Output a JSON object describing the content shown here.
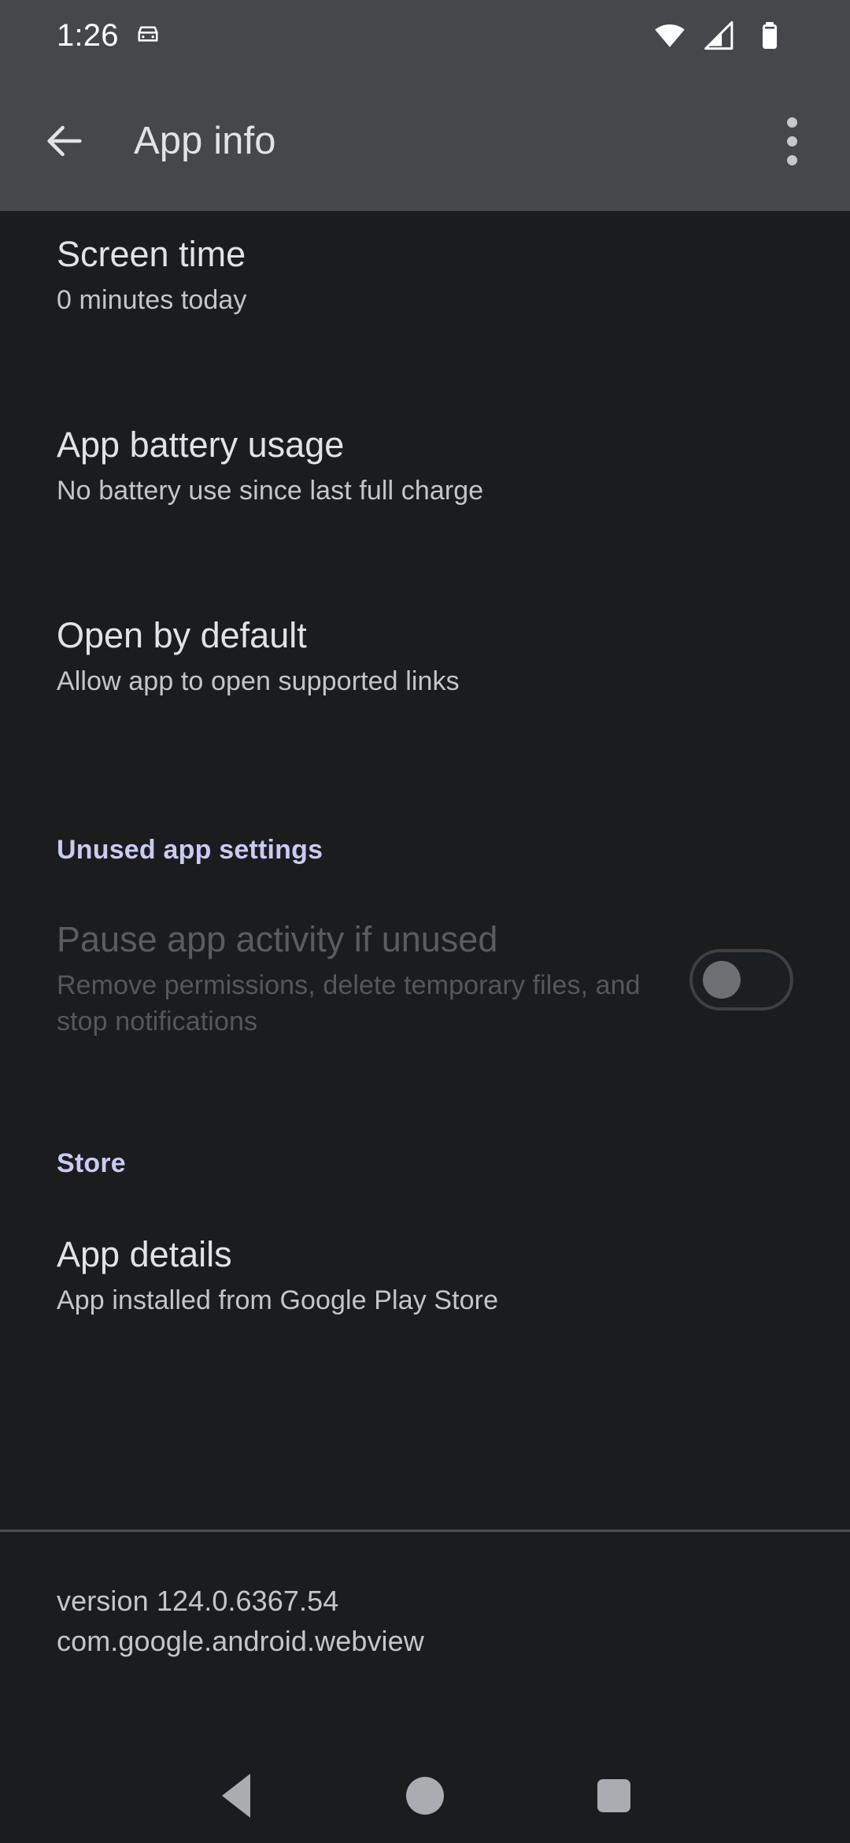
{
  "status_bar": {
    "time": "1:26",
    "icons": [
      "car-icon",
      "wifi-icon",
      "cellular-signal-icon",
      "battery-icon"
    ],
    "background_color": "#46474b",
    "foreground_color": "#ffffff"
  },
  "app_bar": {
    "back_icon": "back-arrow-icon",
    "title": "App info",
    "overflow_icon": "overflow-menu-icon",
    "background_color": "#46474b",
    "title_color": "#e3e2e6"
  },
  "preferences": [
    {
      "key": "screen_time",
      "title": "Screen time",
      "subtitle": "0 minutes today",
      "enabled": true
    },
    {
      "key": "app_battery_usage",
      "title": "App battery usage",
      "subtitle": "No battery use since last full charge",
      "enabled": true
    },
    {
      "key": "open_by_default",
      "title": "Open by default",
      "subtitle": "Allow app to open supported links",
      "enabled": true
    }
  ],
  "sections": {
    "unused_app_settings": {
      "header": "Unused app settings",
      "header_color": "#c8ccf2",
      "item": {
        "title": "Pause app activity if unused",
        "subtitle": "Remove permissions, delete temporary files, and stop notifications",
        "enabled": false,
        "toggle": {
          "name": "pause-app-activity-switch",
          "checked": false,
          "track_color": "#1c1f21",
          "border_color": "#3e4043",
          "thumb_color": "#6c7075"
        }
      }
    },
    "store": {
      "header": "Store",
      "header_color": "#c8ccf2",
      "item": {
        "title": "App details",
        "subtitle": "App installed from Google Play Store",
        "enabled": true
      }
    }
  },
  "footer": {
    "version": "version 124.0.6367.54",
    "package": "com.google.android.webview",
    "divider_color": "#4a4d52"
  },
  "nav_bar": {
    "back_label": "back-button",
    "home_label": "home-button",
    "recents_label": "recents-button",
    "icon_color": "#a9acb0"
  }
}
